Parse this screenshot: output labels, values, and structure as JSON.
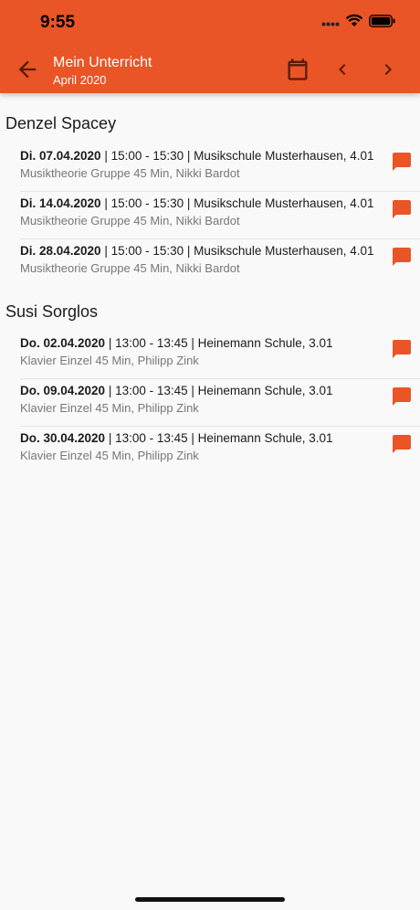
{
  "status": {
    "time": "9:55"
  },
  "header": {
    "title": "Mein Unterricht",
    "subtitle": "April 2020"
  },
  "groups": [
    {
      "name": "Denzel Spacey",
      "entries": [
        {
          "date": "Di. 07.04.2020",
          "details": " | 15:00 - 15:30 | Musikschule Musterhausen, 4.01",
          "course": "Musiktheorie Gruppe 45 Min, Nikki Bardot"
        },
        {
          "date": "Di. 14.04.2020",
          "details": " | 15:00 - 15:30 | Musikschule Musterhausen, 4.01",
          "course": "Musiktheorie Gruppe 45 Min, Nikki Bardot"
        },
        {
          "date": "Di. 28.04.2020",
          "details": " | 15:00 - 15:30 | Musikschule Musterhausen, 4.01",
          "course": "Musiktheorie Gruppe 45 Min, Nikki Bardot"
        }
      ]
    },
    {
      "name": "Susi Sorglos",
      "entries": [
        {
          "date": "Do. 02.04.2020",
          "details": " | 13:00 - 13:45 | Heinemann Schule, 3.01",
          "course": "Klavier Einzel 45 Min, Philipp Zink"
        },
        {
          "date": "Do. 09.04.2020",
          "details": " | 13:00 - 13:45 | Heinemann Schule, 3.01",
          "course": "Klavier Einzel 45 Min, Philipp Zink"
        },
        {
          "date": "Do. 30.04.2020",
          "details": " | 13:00 - 13:45 | Heinemann Schule, 3.01",
          "course": "Klavier Einzel 45 Min, Philipp Zink"
        }
      ]
    }
  ],
  "icons": {
    "back": "arrow-left-icon",
    "calendar": "calendar-icon",
    "prev": "chevron-left-icon",
    "next": "chevron-right-icon",
    "message": "chat-bubble-icon"
  },
  "colors": {
    "accent": "#e95526",
    "background": "#f9f9f9"
  }
}
